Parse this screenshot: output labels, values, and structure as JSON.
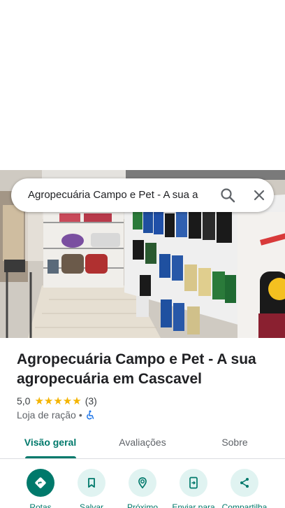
{
  "search": {
    "query": "Agropecuária Campo e Pet - A sua a"
  },
  "place": {
    "title": "Agropecuária Campo e Pet - A sua agropecuária em Cascavel",
    "rating": "5,0",
    "stars": "★★★★★",
    "review_count": "(3)",
    "category": "Loja de ração",
    "separator": "•"
  },
  "tabs": [
    {
      "label": "Visão geral",
      "active": true
    },
    {
      "label": "Avaliações",
      "active": false
    },
    {
      "label": "Sobre",
      "active": false
    }
  ],
  "actions": [
    {
      "label": "Rotas",
      "icon": "directions-icon"
    },
    {
      "label": "Salvar",
      "icon": "bookmark-icon"
    },
    {
      "label": "Próximo",
      "icon": "nearby-icon"
    },
    {
      "label": "Enviar para",
      "icon": "send-to-phone-icon"
    },
    {
      "label": "Compartilha",
      "icon": "share-icon"
    }
  ],
  "colors": {
    "accent": "#00796b",
    "accent_light": "#e0f3f1",
    "star": "#f4b400",
    "accessibility": "#1a73e8"
  }
}
